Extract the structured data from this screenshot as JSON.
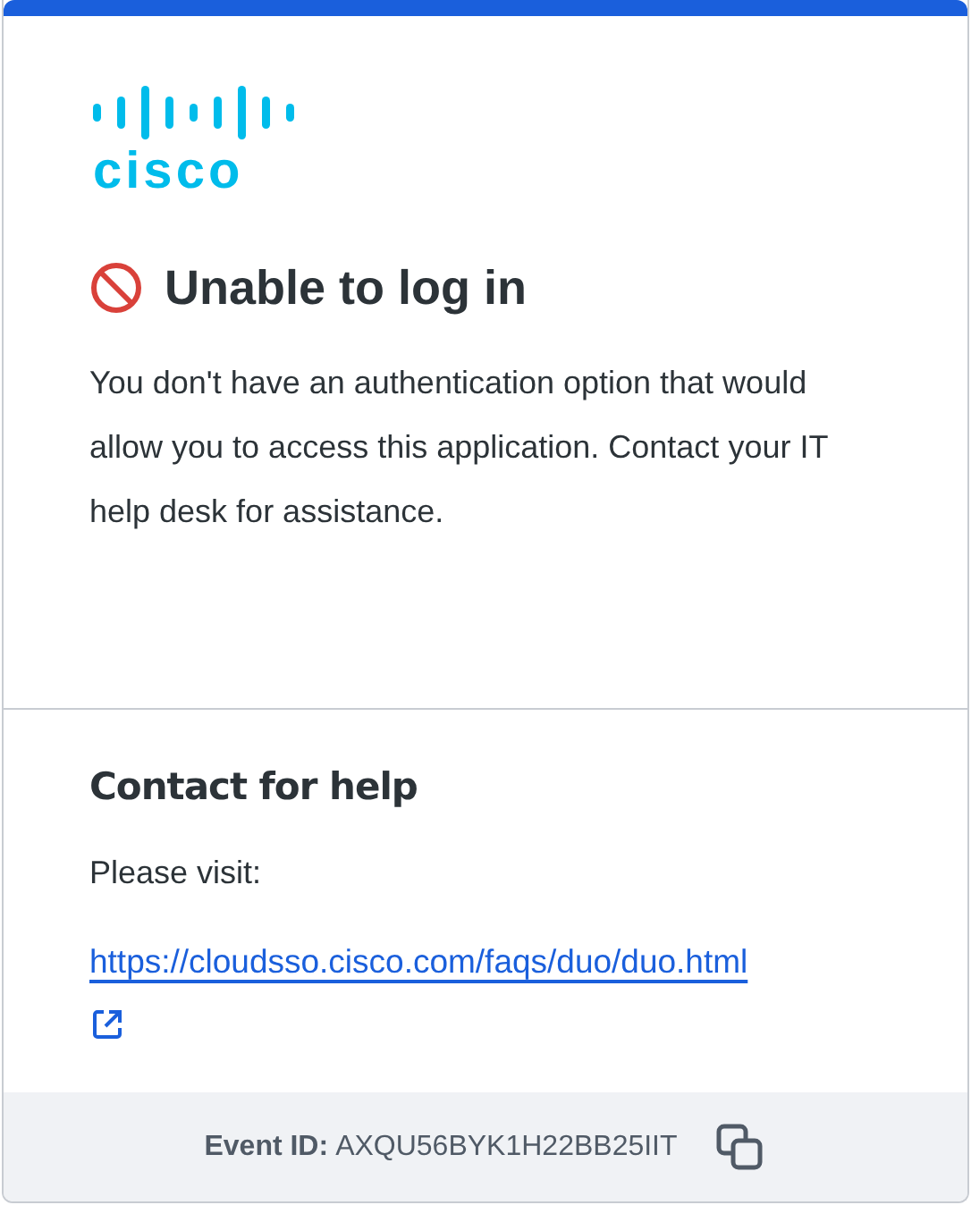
{
  "logo_text": "cisco",
  "title": "Unable to log in",
  "message": "You don't have an authentication option that would allow you to access this application. Contact your IT help desk for assistance.",
  "help": {
    "heading": "Contact for help",
    "intro": "Please visit:",
    "link": "https://cloudsso.cisco.com/faqs/duo/duo.html"
  },
  "footer": {
    "label": "Event ID:",
    "value": "AXQU56BYK1H22BB25IIT"
  }
}
